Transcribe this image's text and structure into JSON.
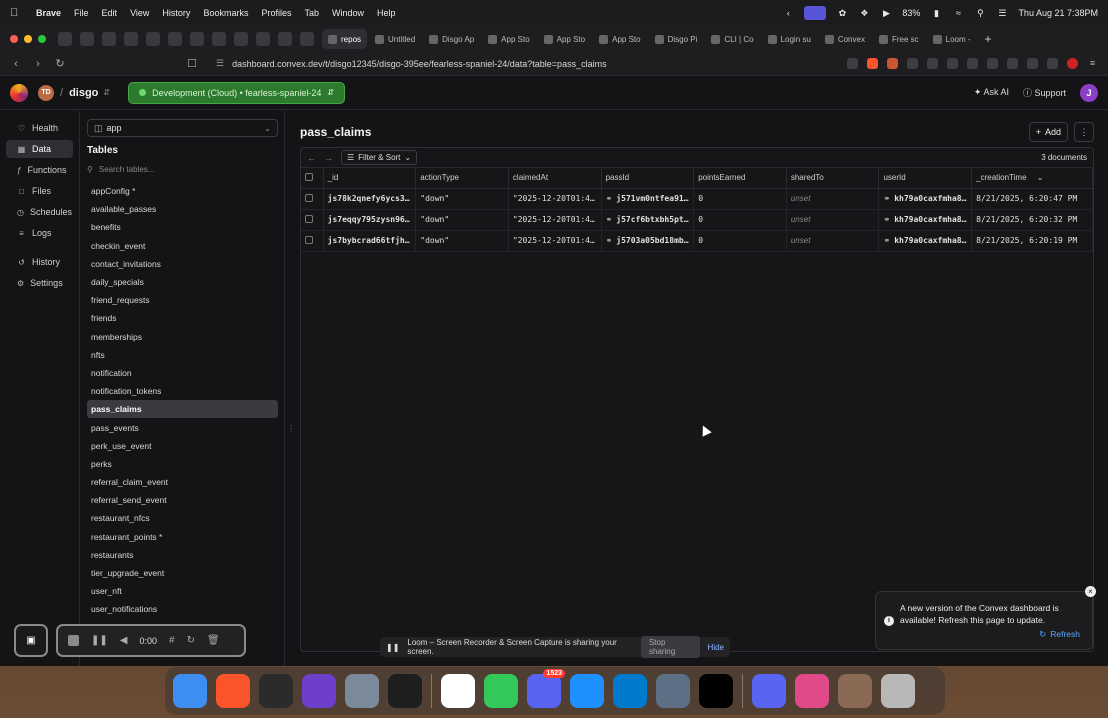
{
  "menubar": {
    "app": "Brave",
    "items": [
      "File",
      "Edit",
      "View",
      "History",
      "Bookmarks",
      "Profiles",
      "Tab",
      "Window",
      "Help"
    ],
    "battery": "83%",
    "datetime": "Thu Aug 21  7:38PM"
  },
  "browser": {
    "tabs": [
      {
        "label": "repos",
        "active": true
      },
      {
        "label": "Untitled",
        "active": false
      },
      {
        "label": "Disgo Ap",
        "active": false
      },
      {
        "label": "App Sto",
        "active": false
      },
      {
        "label": "App Sto",
        "active": false
      },
      {
        "label": "App Sto",
        "active": false
      },
      {
        "label": "Disgo Pi",
        "active": false
      },
      {
        "label": "CLI | Co",
        "active": false
      },
      {
        "label": "Login su",
        "active": false
      },
      {
        "label": "Convex",
        "active": false
      },
      {
        "label": "Free sc",
        "active": false
      },
      {
        "label": "Loom -",
        "active": false
      }
    ],
    "new_tab": "+",
    "url": "dashboard.convex.dev/t/disgo12345/disgo-395ee/fearless-spaniel-24/data?table=pass_claims"
  },
  "header": {
    "team_initials": "TD",
    "separator": "/",
    "project": "disgo",
    "deployment": "Development (Cloud) • fearless-spaniel-24",
    "ask_ai": "Ask AI",
    "support": "Support",
    "user_initial": "J"
  },
  "leftnav": {
    "items": [
      {
        "label": "Health",
        "icon": "heart-icon"
      },
      {
        "label": "Data",
        "icon": "table-icon",
        "active": true
      },
      {
        "label": "Functions",
        "icon": "function-icon"
      },
      {
        "label": "Files",
        "icon": "file-icon"
      },
      {
        "label": "Schedules",
        "icon": "calendar-icon"
      },
      {
        "label": "Logs",
        "icon": "logs-icon"
      }
    ],
    "items2": [
      {
        "label": "History",
        "icon": "history-icon"
      },
      {
        "label": "Settings",
        "icon": "gear-icon"
      }
    ]
  },
  "tables_panel": {
    "component": "app",
    "title": "Tables",
    "search_placeholder": "Search tables...",
    "tables": [
      "appConfig *",
      "available_passes",
      "benefits",
      "checkin_event",
      "contact_invitations",
      "daily_specials",
      "friend_requests",
      "friends",
      "memberships",
      "nfts",
      "notification",
      "notification_tokens",
      "pass_claims",
      "pass_events",
      "perk_use_event",
      "perks",
      "referral_claim_event",
      "referral_send_event",
      "restaurant_nfcs",
      "restaurant_points *",
      "restaurants",
      "tier_upgrade_event",
      "user_nft",
      "user_notifications"
    ],
    "active_table": "pass_claims"
  },
  "main": {
    "title": "pass_claims",
    "add_label": "Add",
    "filter_label": "Filter & Sort",
    "doc_count": "3 documents",
    "columns": [
      "_id",
      "actionType",
      "claimedAt",
      "passId",
      "pointsEarned",
      "sharedTo",
      "userId",
      "_creationTime"
    ],
    "rows": [
      [
        "js78k2qnefy6ycs3bc…",
        "\"down\"",
        "\"2025-12-20T01:42:…",
        "j571vm0ntfea91…",
        "0",
        "unset",
        "kh79a0caxfmha8…",
        "8/21/2025, 6:20:47 PM"
      ],
      [
        "js7eqqy795zysn9669…",
        "\"down\"",
        "\"2025-12-20T01:42:…",
        "j57cf6btxbh5pt…",
        "0",
        "unset",
        "kh79a0caxfmha8…",
        "8/21/2025, 6:20:32 PM"
      ],
      [
        "js7bybcrad66tfjhxd…",
        "\"down\"",
        "\"2025-12-20T01:42:…",
        "j5703a05bd18mb…",
        "0",
        "unset",
        "kh79a0caxfmha8…",
        "8/21/2025, 6:20:19 PM"
      ]
    ]
  },
  "toast": {
    "message": "A new version of the Convex dashboard is available! Refresh this page to update.",
    "action": "Refresh"
  },
  "loom": {
    "share_text": "Loom – Screen Recorder & Screen Capture is sharing your screen.",
    "stop_label": "Stop sharing",
    "hide_label": "Hide",
    "timer": "0:00"
  },
  "dock": {
    "apps": [
      {
        "name": "finder-icon",
        "color": "#3d8ef0"
      },
      {
        "name": "brave-icon",
        "color": "#fb542b"
      },
      {
        "name": "cube-icon",
        "color": "#2b2b2b"
      },
      {
        "name": "github-icon",
        "color": "#6e40c9"
      },
      {
        "name": "xcode-cube-icon",
        "color": "#7a8a9a"
      },
      {
        "name": "terminal-icon",
        "color": "#1e1e1e"
      },
      {
        "name": "slack-icon",
        "color": "#ffffff"
      },
      {
        "name": "messages-icon",
        "color": "#34c759"
      },
      {
        "name": "discord-icon",
        "color": "#5865f2",
        "badge": "1523"
      },
      {
        "name": "app-store-icon",
        "color": "#1e90ff"
      },
      {
        "name": "vscode-icon",
        "color": "#007acc"
      },
      {
        "name": "screen-icon",
        "color": "#5c6f85"
      },
      {
        "name": "x-icon",
        "color": "#000000"
      },
      {
        "name": "discord2-icon",
        "color": "#5865f2"
      },
      {
        "name": "pencil-icon",
        "color": "#e04a8a"
      },
      {
        "name": "photo-icon",
        "color": "#8a6a55"
      },
      {
        "name": "trash-icon",
        "color": "#b8b8b8"
      }
    ]
  }
}
